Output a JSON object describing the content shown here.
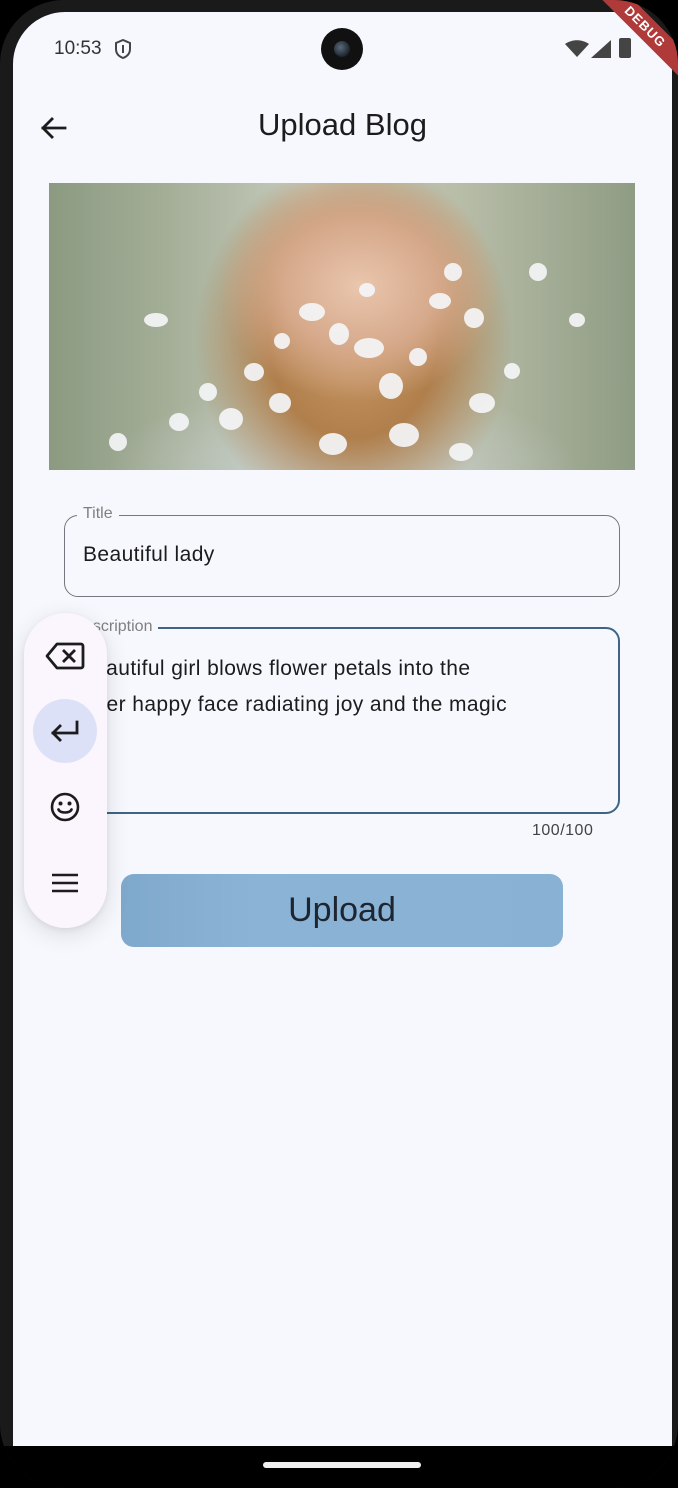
{
  "status_bar": {
    "time": "10:53",
    "debug_label": "DEBUG"
  },
  "app_bar": {
    "title": "Upload Blog",
    "back_icon": "arrow-left-icon"
  },
  "form": {
    "title_field": {
      "label": "Title",
      "value": "Beautiful lady"
    },
    "description_field": {
      "label": "escription",
      "value": "beautiful girl blows flower petals into the\n, her happy face radiating joy and the magic\nna",
      "counter": "100/100"
    },
    "upload_button_label": "Upload"
  },
  "keyboard_toolbar": {
    "items": [
      "backspace-icon",
      "enter-icon",
      "emoji-icon",
      "menu-icon"
    ],
    "active_item": "enter-icon"
  },
  "colors": {
    "background": "#f6f8fe",
    "focus_border": "#3e6583",
    "upload_button": "#89b1d3",
    "debug_banner": "#b03a3a"
  }
}
